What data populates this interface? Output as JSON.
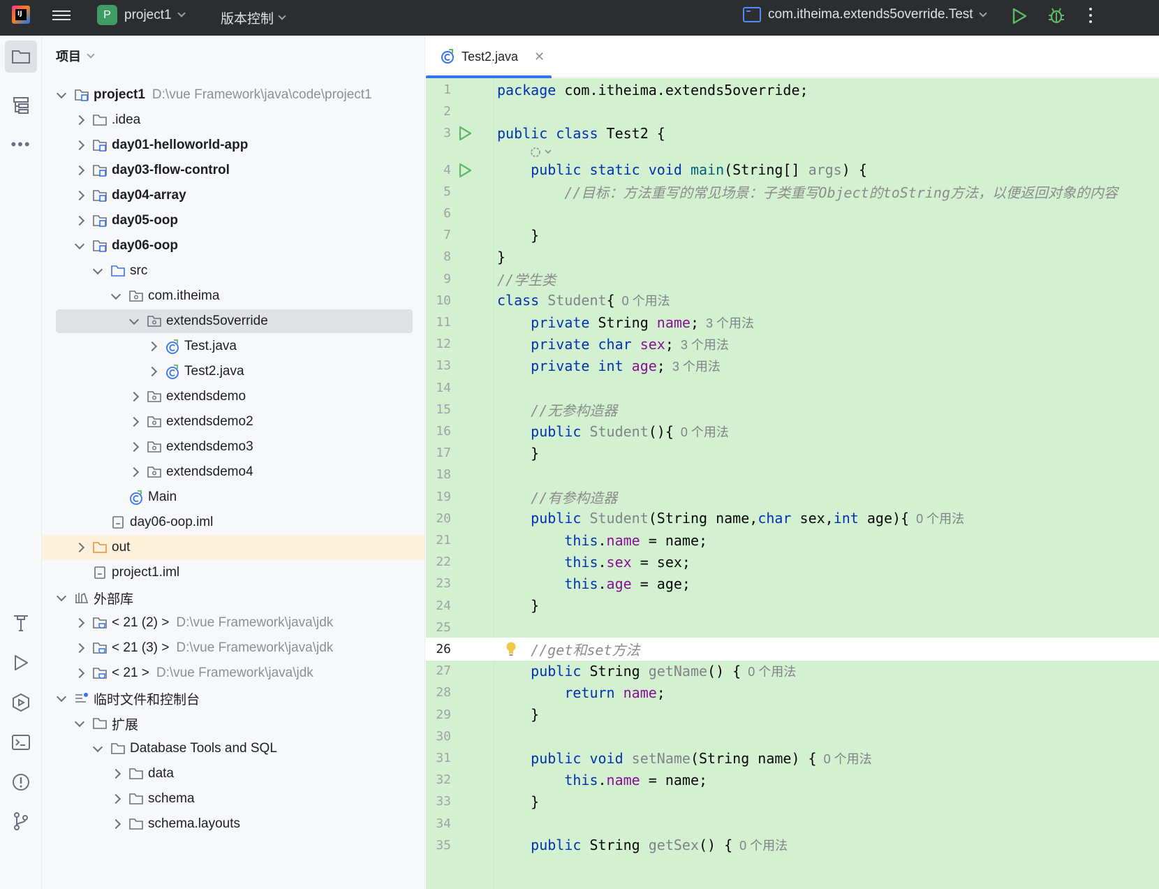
{
  "titlebar": {
    "project_badge": "P",
    "project_name": "project1",
    "vcs_label": "版本控制",
    "run_config": "com.itheima.extends5override.Test"
  },
  "project_panel": {
    "header": "项目",
    "tree": [
      {
        "level": 0,
        "arrow": "open",
        "icon": "module-folder-icon",
        "label": "project1",
        "bold": true,
        "path": "D:\\vue  Framework\\java\\code\\project1"
      },
      {
        "level": 1,
        "arrow": "closed",
        "icon": "folder-icon",
        "label": ".idea"
      },
      {
        "level": 1,
        "arrow": "closed",
        "icon": "module-folder-icon",
        "label": "day01-helloworld-app",
        "bold": true
      },
      {
        "level": 1,
        "arrow": "closed",
        "icon": "module-folder-icon",
        "label": "day03-flow-control",
        "bold": true
      },
      {
        "level": 1,
        "arrow": "closed",
        "icon": "module-folder-icon",
        "label": "day04-array",
        "bold": true
      },
      {
        "level": 1,
        "arrow": "closed",
        "icon": "module-folder-icon",
        "label": "day05-oop",
        "bold": true
      },
      {
        "level": 1,
        "arrow": "open",
        "icon": "module-folder-icon",
        "label": "day06-oop",
        "bold": true
      },
      {
        "level": 2,
        "arrow": "open",
        "icon": "source-folder-icon",
        "label": "src"
      },
      {
        "level": 3,
        "arrow": "open",
        "icon": "package-icon",
        "label": "com.itheima"
      },
      {
        "level": 4,
        "arrow": "open",
        "icon": "package-icon",
        "label": "extends5override",
        "selected": true
      },
      {
        "level": 5,
        "arrow": "closed",
        "icon": "java-class-icon",
        "label": "Test.java"
      },
      {
        "level": 5,
        "arrow": "closed",
        "icon": "java-class-icon",
        "label": "Test2.java"
      },
      {
        "level": 4,
        "arrow": "closed",
        "icon": "package-icon",
        "label": "extendsdemo"
      },
      {
        "level": 4,
        "arrow": "closed",
        "icon": "package-icon",
        "label": "extendsdemo2"
      },
      {
        "level": 4,
        "arrow": "closed",
        "icon": "package-icon",
        "label": "extendsdemo3"
      },
      {
        "level": 4,
        "arrow": "closed",
        "icon": "package-icon",
        "label": "extendsdemo4"
      },
      {
        "level": 3,
        "arrow": "none",
        "icon": "java-class-icon",
        "label": "Main"
      },
      {
        "level": 2,
        "arrow": "none",
        "icon": "iml-file-icon",
        "label": "day06-oop.iml"
      },
      {
        "level": 1,
        "arrow": "closed",
        "icon": "excluded-folder-icon",
        "label": "out",
        "excluded": true
      },
      {
        "level": 1,
        "arrow": "none",
        "icon": "iml-file-icon",
        "label": "project1.iml"
      },
      {
        "level": 0,
        "arrow": "open",
        "icon": "library-icon",
        "label": "外部库"
      },
      {
        "level": 1,
        "arrow": "closed",
        "icon": "jdk-icon",
        "label": "< 21 (2) >",
        "path": "D:\\vue  Framework\\java\\jdk"
      },
      {
        "level": 1,
        "arrow": "closed",
        "icon": "jdk-icon",
        "label": "< 21 (3) >",
        "path": "D:\\vue  Framework\\java\\jdk"
      },
      {
        "level": 1,
        "arrow": "closed",
        "icon": "jdk-icon",
        "label": "< 21 >",
        "path": "D:\\vue  Framework\\java\\jdk"
      },
      {
        "level": 0,
        "arrow": "open",
        "icon": "scratches-icon",
        "label": "临时文件和控制台"
      },
      {
        "level": 1,
        "arrow": "open",
        "icon": "folder-icon",
        "label": "扩展"
      },
      {
        "level": 2,
        "arrow": "open",
        "icon": "folder-icon",
        "label": "Database Tools and SQL"
      },
      {
        "level": 3,
        "arrow": "closed",
        "icon": "folder-icon",
        "label": "data"
      },
      {
        "level": 3,
        "arrow": "closed",
        "icon": "folder-icon",
        "label": "schema"
      },
      {
        "level": 3,
        "arrow": "closed",
        "icon": "folder-icon",
        "label": "schema.layouts"
      }
    ]
  },
  "editor": {
    "tab_label": "Test2.java",
    "current_line": 26,
    "lines": [
      {
        "n": "1",
        "segs": [
          [
            "kw",
            "package"
          ],
          [
            "plain",
            " com.itheima.extends5override;"
          ]
        ]
      },
      {
        "n": "2",
        "segs": []
      },
      {
        "n": "3",
        "run": true,
        "segs": [
          [
            "kw",
            "public class"
          ],
          [
            "plain",
            " Test2 {"
          ]
        ]
      },
      {
        "n": "4",
        "run": true,
        "segs": [
          [
            "plain",
            "    "
          ],
          [
            "kw",
            "public static void"
          ],
          [
            "plain",
            " "
          ],
          [
            "fn",
            "main"
          ],
          [
            "plain",
            "(String[] "
          ],
          [
            "gr",
            "args"
          ],
          [
            "plain",
            ") {"
          ]
        ]
      },
      {
        "n": "5",
        "segs": [
          [
            "plain",
            "        "
          ],
          [
            "cm",
            "//目标：方法重写的常见场景：子类重写Object的toString方法，以便返回对象的内容"
          ]
        ]
      },
      {
        "n": "6",
        "segs": []
      },
      {
        "n": "7",
        "segs": [
          [
            "plain",
            "    }"
          ]
        ]
      },
      {
        "n": "8",
        "segs": [
          [
            "plain",
            "}"
          ]
        ]
      },
      {
        "n": "9",
        "segs": [
          [
            "cm",
            "//学生类"
          ]
        ]
      },
      {
        "n": "10",
        "segs": [
          [
            "kw",
            "class"
          ],
          [
            "plain",
            " "
          ],
          [
            "gr",
            "Student"
          ],
          [
            "plain",
            "{"
          ]
        ],
        "hint": "0 个用法"
      },
      {
        "n": "11",
        "segs": [
          [
            "plain",
            "    "
          ],
          [
            "kw",
            "private"
          ],
          [
            "plain",
            " String "
          ],
          [
            "fld",
            "name"
          ],
          [
            "plain",
            ";"
          ]
        ],
        "hint": "3 个用法"
      },
      {
        "n": "12",
        "segs": [
          [
            "plain",
            "    "
          ],
          [
            "kw",
            "private char"
          ],
          [
            "plain",
            " "
          ],
          [
            "fld",
            "sex"
          ],
          [
            "plain",
            ";"
          ]
        ],
        "hint": "3 个用法"
      },
      {
        "n": "13",
        "segs": [
          [
            "plain",
            "    "
          ],
          [
            "kw",
            "private int"
          ],
          [
            "plain",
            " "
          ],
          [
            "fld",
            "age"
          ],
          [
            "plain",
            ";"
          ]
        ],
        "hint": "3 个用法"
      },
      {
        "n": "14",
        "segs": []
      },
      {
        "n": "15",
        "segs": [
          [
            "plain",
            "    "
          ],
          [
            "cm",
            "//无参构造器"
          ]
        ]
      },
      {
        "n": "16",
        "segs": [
          [
            "plain",
            "    "
          ],
          [
            "kw",
            "public"
          ],
          [
            "plain",
            " "
          ],
          [
            "gr",
            "Student"
          ],
          [
            "plain",
            "(){"
          ]
        ],
        "hint": "0 个用法"
      },
      {
        "n": "17",
        "segs": [
          [
            "plain",
            "    }"
          ]
        ]
      },
      {
        "n": "18",
        "segs": []
      },
      {
        "n": "19",
        "segs": [
          [
            "plain",
            "    "
          ],
          [
            "cm",
            "//有参构造器"
          ]
        ]
      },
      {
        "n": "20",
        "segs": [
          [
            "plain",
            "    "
          ],
          [
            "kw",
            "public"
          ],
          [
            "plain",
            " "
          ],
          [
            "gr",
            "Student"
          ],
          [
            "plain",
            "(String name,"
          ],
          [
            "kw",
            "char"
          ],
          [
            "plain",
            " sex,"
          ],
          [
            "kw",
            "int"
          ],
          [
            "plain",
            " age){"
          ]
        ],
        "hint": "0 个用法"
      },
      {
        "n": "21",
        "segs": [
          [
            "plain",
            "        "
          ],
          [
            "kw",
            "this"
          ],
          [
            "plain",
            "."
          ],
          [
            "fld",
            "name"
          ],
          [
            "plain",
            " = name;"
          ]
        ]
      },
      {
        "n": "22",
        "segs": [
          [
            "plain",
            "        "
          ],
          [
            "kw",
            "this"
          ],
          [
            "plain",
            "."
          ],
          [
            "fld",
            "sex"
          ],
          [
            "plain",
            " = sex;"
          ]
        ]
      },
      {
        "n": "23",
        "segs": [
          [
            "plain",
            "        "
          ],
          [
            "kw",
            "this"
          ],
          [
            "plain",
            "."
          ],
          [
            "fld",
            "age"
          ],
          [
            "plain",
            " = age;"
          ]
        ]
      },
      {
        "n": "24",
        "segs": [
          [
            "plain",
            "    }"
          ]
        ]
      },
      {
        "n": "25",
        "segs": []
      },
      {
        "n": "26",
        "bulb": true,
        "segs": [
          [
            "plain",
            "    "
          ],
          [
            "cm",
            "//get和set方法"
          ]
        ]
      },
      {
        "n": "27",
        "segs": [
          [
            "plain",
            "    "
          ],
          [
            "kw",
            "public"
          ],
          [
            "plain",
            " String "
          ],
          [
            "gr",
            "getName"
          ],
          [
            "plain",
            "() {"
          ]
        ],
        "hint": "0 个用法"
      },
      {
        "n": "28",
        "segs": [
          [
            "plain",
            "        "
          ],
          [
            "kw",
            "return"
          ],
          [
            "plain",
            " "
          ],
          [
            "fld",
            "name"
          ],
          [
            "plain",
            ";"
          ]
        ]
      },
      {
        "n": "29",
        "segs": [
          [
            "plain",
            "    }"
          ]
        ]
      },
      {
        "n": "30",
        "segs": []
      },
      {
        "n": "31",
        "segs": [
          [
            "plain",
            "    "
          ],
          [
            "kw",
            "public void"
          ],
          [
            "plain",
            " "
          ],
          [
            "gr",
            "setName"
          ],
          [
            "plain",
            "(String name) {"
          ]
        ],
        "hint": "0 个用法"
      },
      {
        "n": "32",
        "segs": [
          [
            "plain",
            "        "
          ],
          [
            "kw",
            "this"
          ],
          [
            "plain",
            "."
          ],
          [
            "fld",
            "name"
          ],
          [
            "plain",
            " = name;"
          ]
        ]
      },
      {
        "n": "33",
        "segs": [
          [
            "plain",
            "    }"
          ]
        ]
      },
      {
        "n": "34",
        "segs": []
      },
      {
        "n": "35",
        "segs": [
          [
            "plain",
            "    "
          ],
          [
            "kw",
            "public"
          ],
          [
            "plain",
            " String "
          ],
          [
            "gr",
            "getSex"
          ],
          [
            "plain",
            "() {"
          ]
        ],
        "hint": "0 个用法"
      }
    ]
  },
  "colors": {
    "titlebar_bg": "#2b2d30",
    "accent": "#3574f0",
    "run_green": "#5fb865",
    "code_bg": "#d3f0d0",
    "keyword": "#0033b3",
    "field": "#871094",
    "comment": "#8c8c8c"
  }
}
